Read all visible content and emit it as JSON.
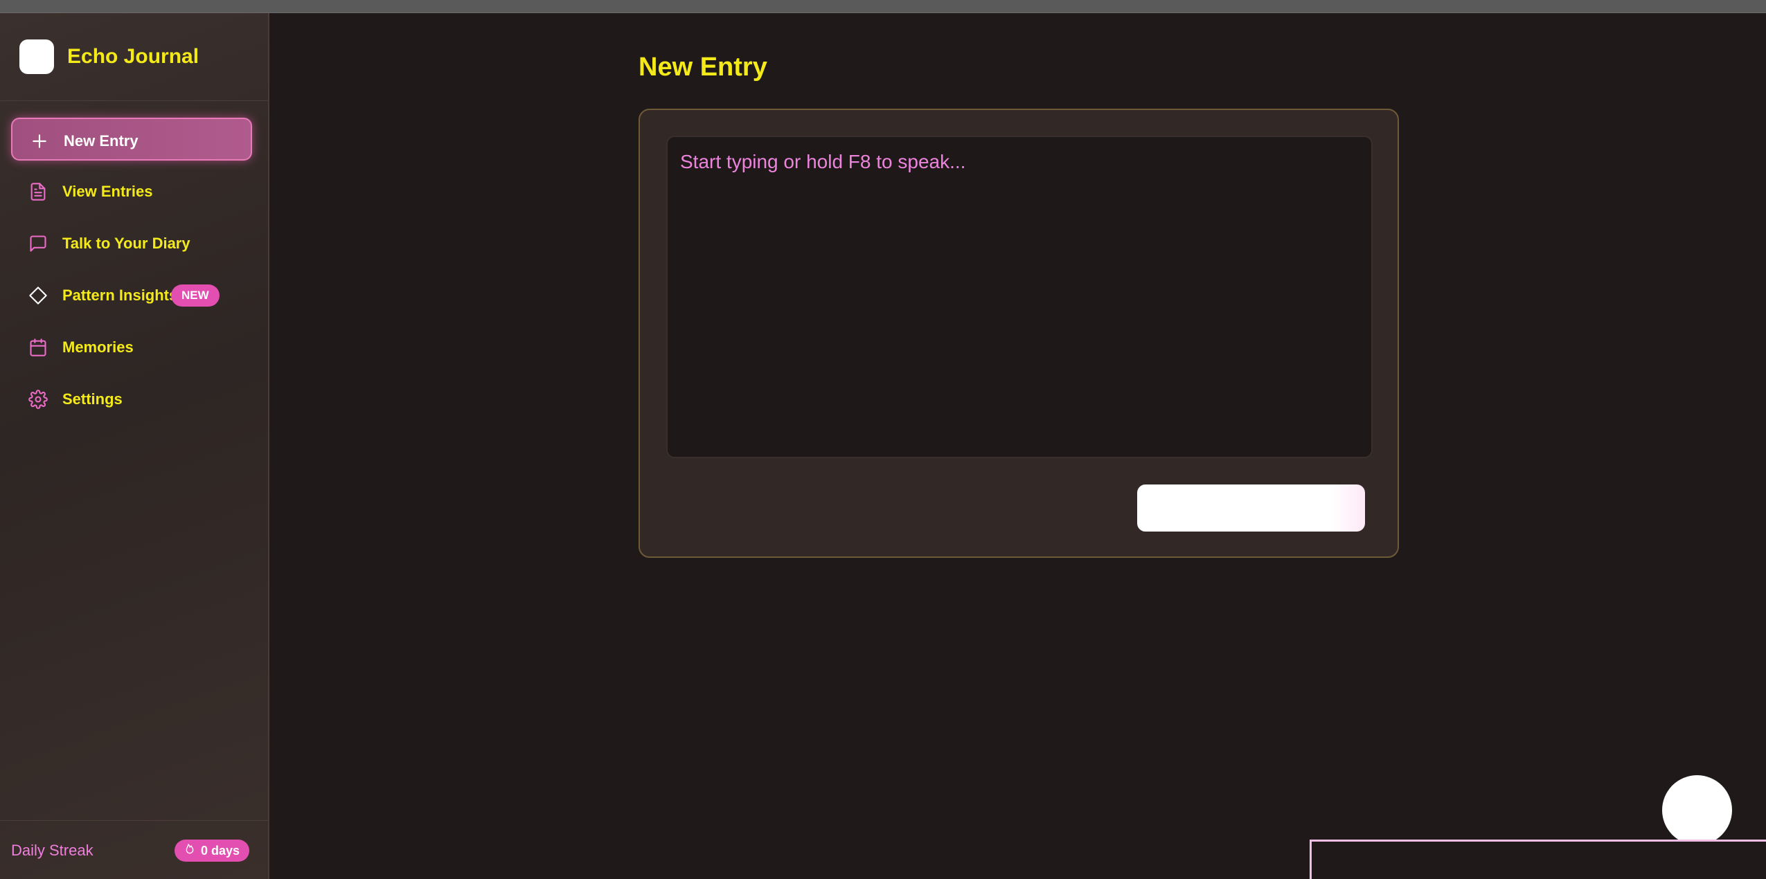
{
  "app": {
    "title": "Echo Journal"
  },
  "sidebar": {
    "items": [
      {
        "label": "New Entry",
        "icon": "plus-icon",
        "active": true
      },
      {
        "label": "View Entries",
        "icon": "document-icon",
        "active": false
      },
      {
        "label": "Talk to Your Diary",
        "icon": "chat-bubble-icon",
        "active": false
      },
      {
        "label": "Pattern Insights",
        "icon": "diamond-icon",
        "active": false,
        "badge": "NEW"
      },
      {
        "label": "Memories",
        "icon": "calendar-icon",
        "active": false
      },
      {
        "label": "Settings",
        "icon": "gear-icon",
        "active": false
      }
    ],
    "streak": {
      "label": "Daily Streak",
      "value": "0 days",
      "icon": "flame-icon"
    }
  },
  "main": {
    "title": "New Entry",
    "editor": {
      "placeholder": "Start typing or hold F8 to speak...",
      "value": ""
    },
    "save_button": {
      "label": ""
    }
  },
  "colors": {
    "accent_yellow": "#f4ea1a",
    "accent_pink": "#e34fb0",
    "placeholder_pink": "#ec84dd",
    "background": "#1f1a19"
  }
}
